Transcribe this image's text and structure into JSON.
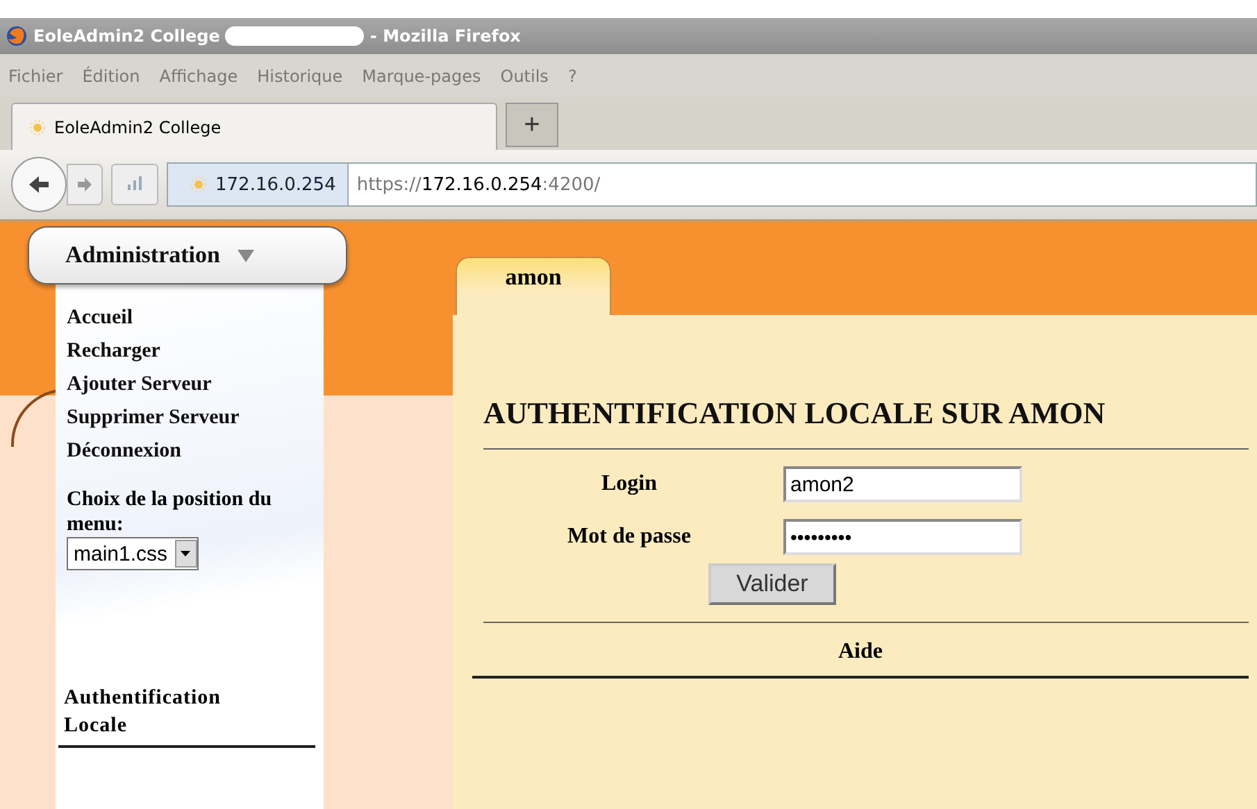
{
  "window": {
    "title": "EoleAdmin2 College",
    "title_suffix": "- Mozilla Firefox"
  },
  "menu": [
    "Fichier",
    "Édition",
    "Affichage",
    "Historique",
    "Marque-pages",
    "Outils",
    "?"
  ],
  "tab": {
    "label": "EoleAdmin2 College"
  },
  "new_tab": "+",
  "address": {
    "site": "172.16.0.254",
    "url_prefix": "https://",
    "url_host": "172.16.0.254",
    "url_port": ":4200/"
  },
  "sidebar": {
    "menu_button": "Administration",
    "items": [
      "Accueil",
      "Recharger",
      "Ajouter Serveur",
      "Supprimer Serveur",
      "Déconnexion"
    ],
    "position_label": "Choix de la position du menu:",
    "position_select": "main1.css",
    "section": "Authentification Locale"
  },
  "content": {
    "tabs": [
      {
        "label": "amon",
        "selected": true
      }
    ],
    "heading": "AUTHENTIFICATION LOCALE SUR AMON",
    "fields": [
      {
        "label": "Login",
        "value": "amon2",
        "kind": "text"
      },
      {
        "label": "Mot de passe",
        "value": "•••••••••",
        "kind": "password"
      }
    ],
    "submit": "Valider",
    "help": "Aide"
  }
}
